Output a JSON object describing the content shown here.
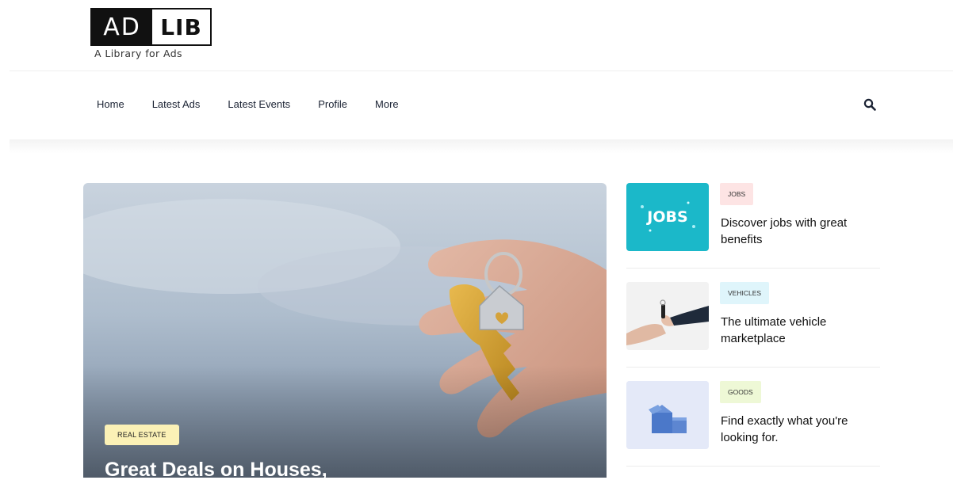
{
  "logo": {
    "left": "AD",
    "right": "LIB",
    "tagline": "A Library for Ads"
  },
  "nav": {
    "items": [
      "Home",
      "Latest Ads",
      "Latest Events",
      "Profile",
      "More"
    ]
  },
  "hero": {
    "category": "REAL ESTATE",
    "title": "Great Deals on Houses,"
  },
  "side": [
    {
      "category": "JOBS",
      "title": "Discover jobs with great benefits",
      "badge_color": "#fde4e4",
      "thumb_text": "JOBS"
    },
    {
      "category": "VEHICLES",
      "title": "The ultimate vehicle marketplace",
      "badge_color": "#dff5fb"
    },
    {
      "category": "GOODS",
      "title": "Find exactly what you're looking for.",
      "badge_color": "#eef8d6"
    }
  ],
  "colors": {
    "jobs_thumb": "#1bb8c9",
    "nav_text": "#1a2233"
  }
}
